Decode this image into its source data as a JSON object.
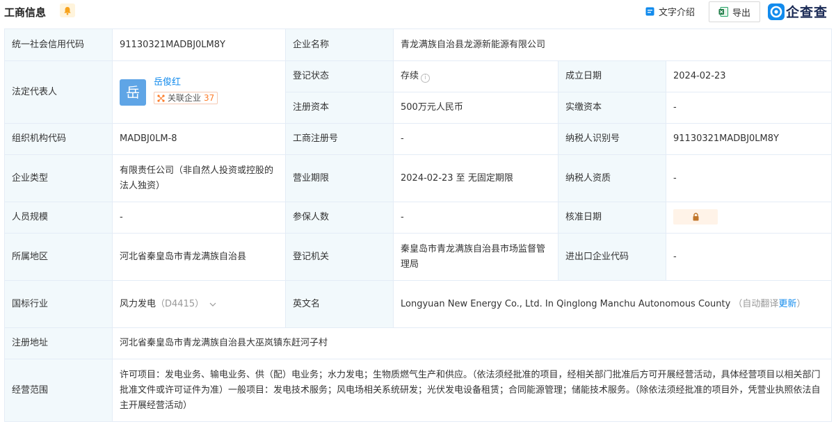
{
  "header": {
    "title": "工商信息",
    "text_intro_label": "文字介绍",
    "export_label": "导出",
    "brand_name": "企查查"
  },
  "colors": {
    "accent": "#128bed",
    "label_bg": "#f2f9fc",
    "border": "#e4ecf6",
    "badge_orange": "#fd7d2b"
  },
  "rows": {
    "credit_code": {
      "label": "统一社会信用代码",
      "value": "91130321MADBJ0LM8Y"
    },
    "company_name": {
      "label": "企业名称",
      "value": "青龙满族自治县龙源新能源有限公司"
    },
    "legal_rep": {
      "label": "法定代表人",
      "avatar_char": "岳",
      "name": "岳俊红",
      "related_label": "关联企业",
      "related_count": "37"
    },
    "reg_status": {
      "label": "登记状态",
      "value": "存续"
    },
    "found_date": {
      "label": "成立日期",
      "value": "2024-02-23"
    },
    "reg_capital": {
      "label": "注册资本",
      "value": "500万元人民币"
    },
    "paid_capital": {
      "label": "实缴资本",
      "value": "-"
    },
    "org_code": {
      "label": "组织机构代码",
      "value": "MADBJ0LM-8"
    },
    "reg_no": {
      "label": "工商注册号",
      "value": "-"
    },
    "taxpayer_id": {
      "label": "纳税人识别号",
      "value": "91130321MADBJ0LM8Y"
    },
    "company_type": {
      "label": "企业类型",
      "value": "有限责任公司（非自然人投资或控股的法人独资）"
    },
    "business_term": {
      "label": "营业期限",
      "value": "2024-02-23 至 无固定期限"
    },
    "taxpayer_qual": {
      "label": "纳税人资质",
      "value": "-"
    },
    "staff_size": {
      "label": "人员规模",
      "value": "-"
    },
    "insured": {
      "label": "参保人数",
      "value": "-"
    },
    "approval_date": {
      "label": "核准日期"
    },
    "region": {
      "label": "所属地区",
      "value": "河北省秦皇岛市青龙满族自治县"
    },
    "reg_authority": {
      "label": "登记机关",
      "value": "秦皇岛市青龙满族自治县市场监督管理局"
    },
    "ie_code": {
      "label": "进出口企业代码",
      "value": "-"
    },
    "industry": {
      "label": "国标行业",
      "value": "风力发电",
      "code": "（D4415）"
    },
    "english_name": {
      "label": "英文名",
      "value": "Longyuan New Energy Co., Ltd. In Qinglong Manchu Autonomous County",
      "auto_prefix": "（自动翻译",
      "more_link": "更新",
      "auto_suffix": "）"
    },
    "reg_address": {
      "label": "注册地址",
      "value": "河北省秦皇岛市青龙满族自治县大巫岚镇东赶河子村"
    },
    "business_scope": {
      "label": "经营范围",
      "value": "许可项目：发电业务、输电业务、供（配）电业务；水力发电；生物质燃气生产和供应。（依法须经批准的项目，经相关部门批准后方可开展经营活动，具体经营项目以相关部门批准文件或许可证件为准）一般项目：发电技术服务；风电场相关系统研发；光伏发电设备租赁；合同能源管理；储能技术服务。（除依法须经批准的项目外，凭营业执照依法自主开展经营活动）"
    }
  }
}
